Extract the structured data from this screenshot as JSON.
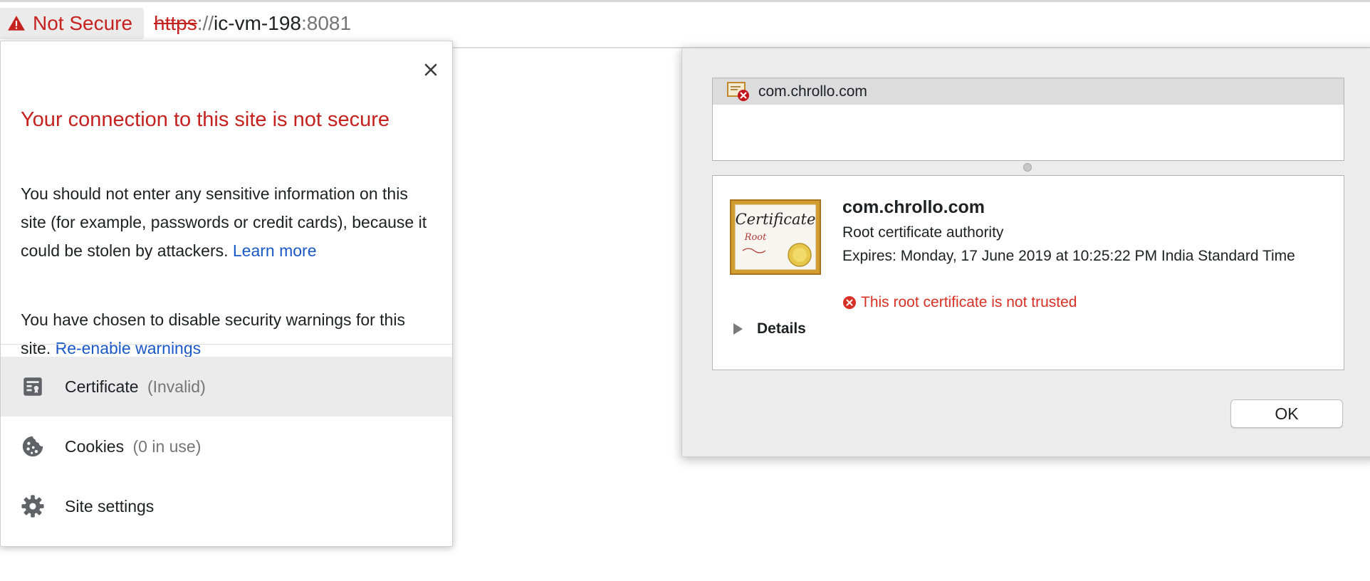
{
  "address_bar": {
    "security_label": "Not Secure",
    "security_icon": "warning-triangle-icon",
    "url_scheme": "https",
    "url_separator": "://",
    "url_host": "ic-vm-198",
    "url_port": ":8081"
  },
  "site_info_popup": {
    "title": "Your connection to this site is not secure",
    "warning_text": "You should not enter any sensitive information on this site (for example, passwords or credit cards), because it could be stolen by attackers.",
    "learn_more_link": "Learn more",
    "disabled_text": "You have chosen to disable security warnings for this site.",
    "reenable_link": "Re-enable warnings",
    "rows": [
      {
        "label": "Certificate",
        "note": "(Invalid)",
        "icon": "certificate-icon"
      },
      {
        "label": "Cookies",
        "note": "(0 in use)",
        "icon": "cookie-icon"
      },
      {
        "label": "Site settings",
        "note": "",
        "icon": "gear-icon"
      }
    ]
  },
  "certificate_dialog": {
    "list_item": "com.chrollo.com",
    "cert_image_text_1": "Certificate",
    "cert_image_text_2": "Root",
    "name": "com.chrollo.com",
    "subtitle": "Root certificate authority",
    "expires": "Expires: Monday, 17 June 2019 at 10:25:22 PM India Standard Time",
    "error": "This root certificate is not trusted",
    "details_label": "Details",
    "ok_label": "OK"
  },
  "colors": {
    "warning_red": "#c5221f",
    "error_red": "#d93025",
    "link_blue": "#1a57c7"
  }
}
